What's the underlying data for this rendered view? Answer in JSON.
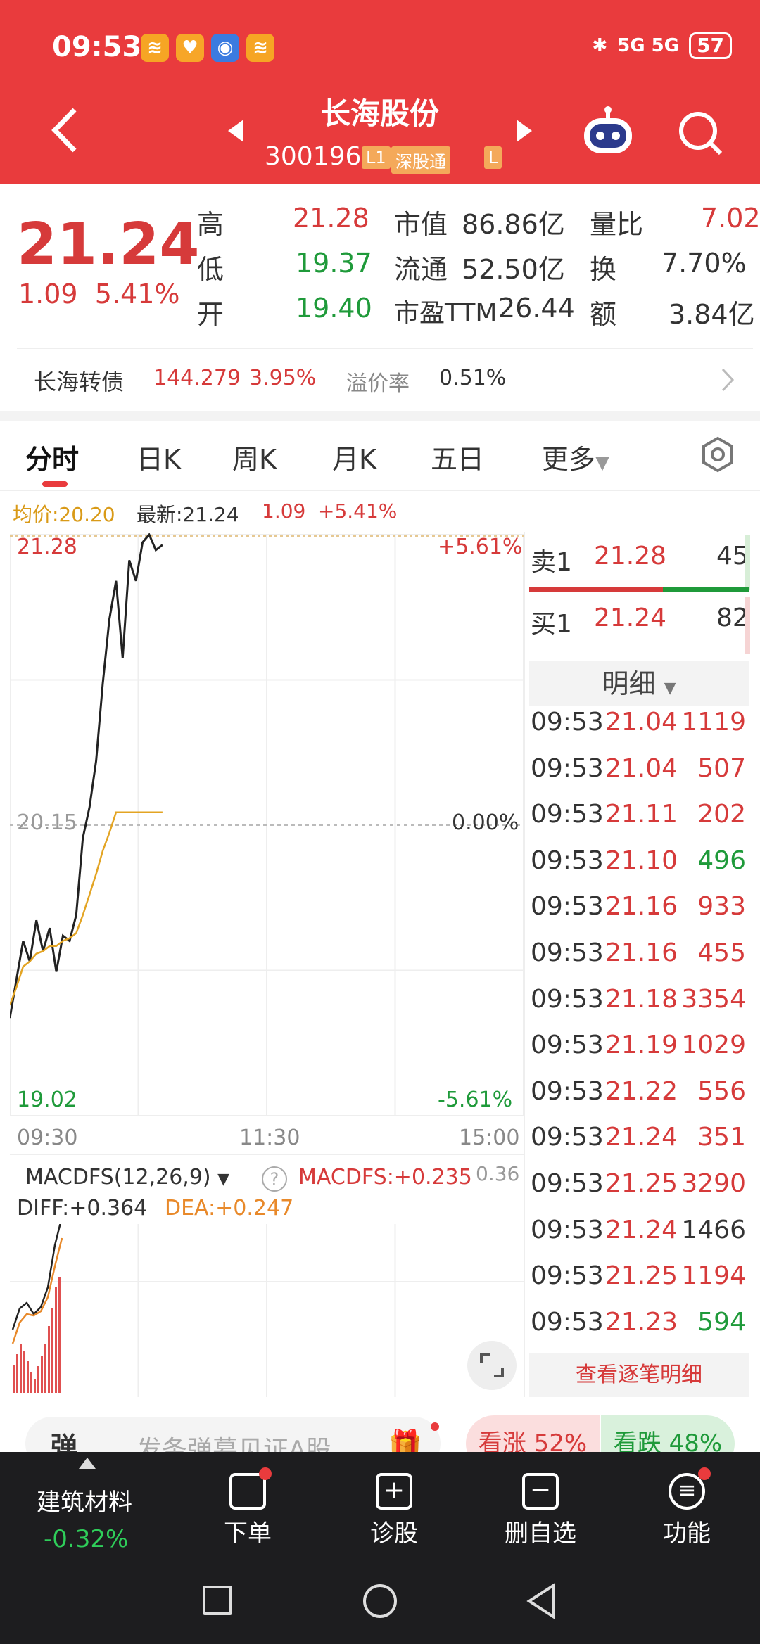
{
  "status_bar": {
    "time": "09:53",
    "network": "5G 5G",
    "battery": "57"
  },
  "header": {
    "title": "长海股份",
    "code": "300196",
    "tag1": "L1",
    "tag2": "深股通",
    "tag3": "L"
  },
  "quote": {
    "price": "21.24",
    "change": "1.09",
    "change_pct": "5.41%",
    "high_label": "高",
    "high": "21.28",
    "low_label": "低",
    "low": "19.37",
    "open_label": "开",
    "open": "19.40",
    "mktcap_label": "市值",
    "mktcap": "86.86亿",
    "float_label": "流通",
    "float": "52.50亿",
    "pe_label": "市盈TTM",
    "pe": "26.44",
    "volratio_label": "量比",
    "volratio": "7.02",
    "turnover_label": "换",
    "turnover": "7.70%",
    "amount_label": "额",
    "amount": "3.84亿"
  },
  "bond": {
    "name": "长海转债",
    "price": "144.279",
    "pct": "3.95%",
    "premium_label": "溢价率",
    "premium": "0.51%"
  },
  "tabs": [
    "分时",
    "日K",
    "周K",
    "月K",
    "五日",
    "更多"
  ],
  "chart_info": {
    "avg_label": "均价:20.20",
    "latest_label": "最新:21.24",
    "change": "1.09",
    "change_pct": "+5.41%"
  },
  "chart_axes": {
    "top_price": "21.28",
    "mid_price": "20.15",
    "bottom_price": "19.02",
    "top_pct": "+5.61%",
    "mid_pct": "0.00%",
    "bottom_pct": "-5.61%",
    "time_start": "09:30",
    "time_mid": "11:30",
    "time_end": "15:00"
  },
  "macd": {
    "label": "MACDFS(12,26,9)",
    "value_label": "MACDFS:+0.235",
    "diff": "DIFF:+0.364",
    "dea": "DEA:+0.247",
    "axis": "0.36"
  },
  "chart_data": {
    "type": "line",
    "series": [
      {
        "name": "最新",
        "x": [
          "09:30",
          "09:31",
          "09:32",
          "09:33",
          "09:34",
          "09:35",
          "09:36",
          "09:37",
          "09:38",
          "09:39",
          "09:40",
          "09:41",
          "09:42",
          "09:43",
          "09:44",
          "09:45",
          "09:46",
          "09:47",
          "09:48",
          "09:49",
          "09:50",
          "09:51",
          "09:52",
          "09:53"
        ],
        "values": [
          19.4,
          19.55,
          19.7,
          19.62,
          19.78,
          19.66,
          19.75,
          19.58,
          19.72,
          19.7,
          19.8,
          20.1,
          20.22,
          20.4,
          20.7,
          20.95,
          21.1,
          20.8,
          21.18,
          21.1,
          21.25,
          21.28,
          21.22,
          21.24
        ]
      },
      {
        "name": "均价",
        "x": [
          "09:30",
          "09:31",
          "09:32",
          "09:33",
          "09:34",
          "09:35",
          "09:36",
          "09:37",
          "09:38",
          "09:39",
          "09:40",
          "09:41",
          "09:42",
          "09:43",
          "09:44",
          "09:45",
          "09:46",
          "09:47",
          "09:48",
          "09:49",
          "09:50",
          "09:51",
          "09:52",
          "09:53"
        ],
        "values": [
          19.45,
          19.52,
          19.6,
          19.62,
          19.65,
          19.66,
          19.68,
          19.68,
          19.7,
          19.71,
          19.73,
          19.8,
          19.88,
          19.96,
          20.05,
          20.12,
          20.2,
          20.2,
          20.2,
          20.2,
          20.2,
          20.2,
          20.2,
          20.2
        ]
      }
    ],
    "ylim": [
      19.02,
      21.28
    ]
  },
  "orderbook": {
    "sell_label": "卖1",
    "sell_price": "21.28",
    "sell_vol": "45",
    "buy_label": "买1",
    "buy_price": "21.24",
    "buy_vol": "82",
    "detail_label": "明细"
  },
  "ticks": [
    {
      "time": "09:53",
      "price": "21.04",
      "vol": "1119",
      "dir": "up"
    },
    {
      "time": "09:53",
      "price": "21.04",
      "vol": "507",
      "dir": "up"
    },
    {
      "time": "09:53",
      "price": "21.11",
      "vol": "202",
      "dir": "up"
    },
    {
      "time": "09:53",
      "price": "21.10",
      "vol": "496",
      "dir": "down"
    },
    {
      "time": "09:53",
      "price": "21.16",
      "vol": "933",
      "dir": "up"
    },
    {
      "time": "09:53",
      "price": "21.16",
      "vol": "455",
      "dir": "up"
    },
    {
      "time": "09:53",
      "price": "21.18",
      "vol": "3354",
      "dir": "up"
    },
    {
      "time": "09:53",
      "price": "21.19",
      "vol": "1029",
      "dir": "up"
    },
    {
      "time": "09:53",
      "price": "21.22",
      "vol": "556",
      "dir": "up"
    },
    {
      "time": "09:53",
      "price": "21.24",
      "vol": "351",
      "dir": "up"
    },
    {
      "time": "09:53",
      "price": "21.25",
      "vol": "3290",
      "dir": "up"
    },
    {
      "time": "09:53",
      "price": "21.24",
      "vol": "1466",
      "dir": "flat"
    },
    {
      "time": "09:53",
      "price": "21.25",
      "vol": "1194",
      "dir": "up"
    },
    {
      "time": "09:53",
      "price": "21.23",
      "vol": "594",
      "dir": "down"
    }
  ],
  "ticks_more": "查看逐笔明细",
  "danmu": {
    "label": "弹",
    "placeholder": "发条弹幕见证A股",
    "up": "看涨 52%",
    "down": "看跌 48%"
  },
  "bottom": {
    "sector_name": "建筑材料",
    "sector_change": "-0.32%",
    "order": "下单",
    "diagnose": "诊股",
    "remove": "删自选",
    "more": "功能"
  },
  "colors": {
    "header": "#e93b3d",
    "up": "#d63a3a",
    "down": "#1f9a3a",
    "avg_line": "#e3a423"
  }
}
